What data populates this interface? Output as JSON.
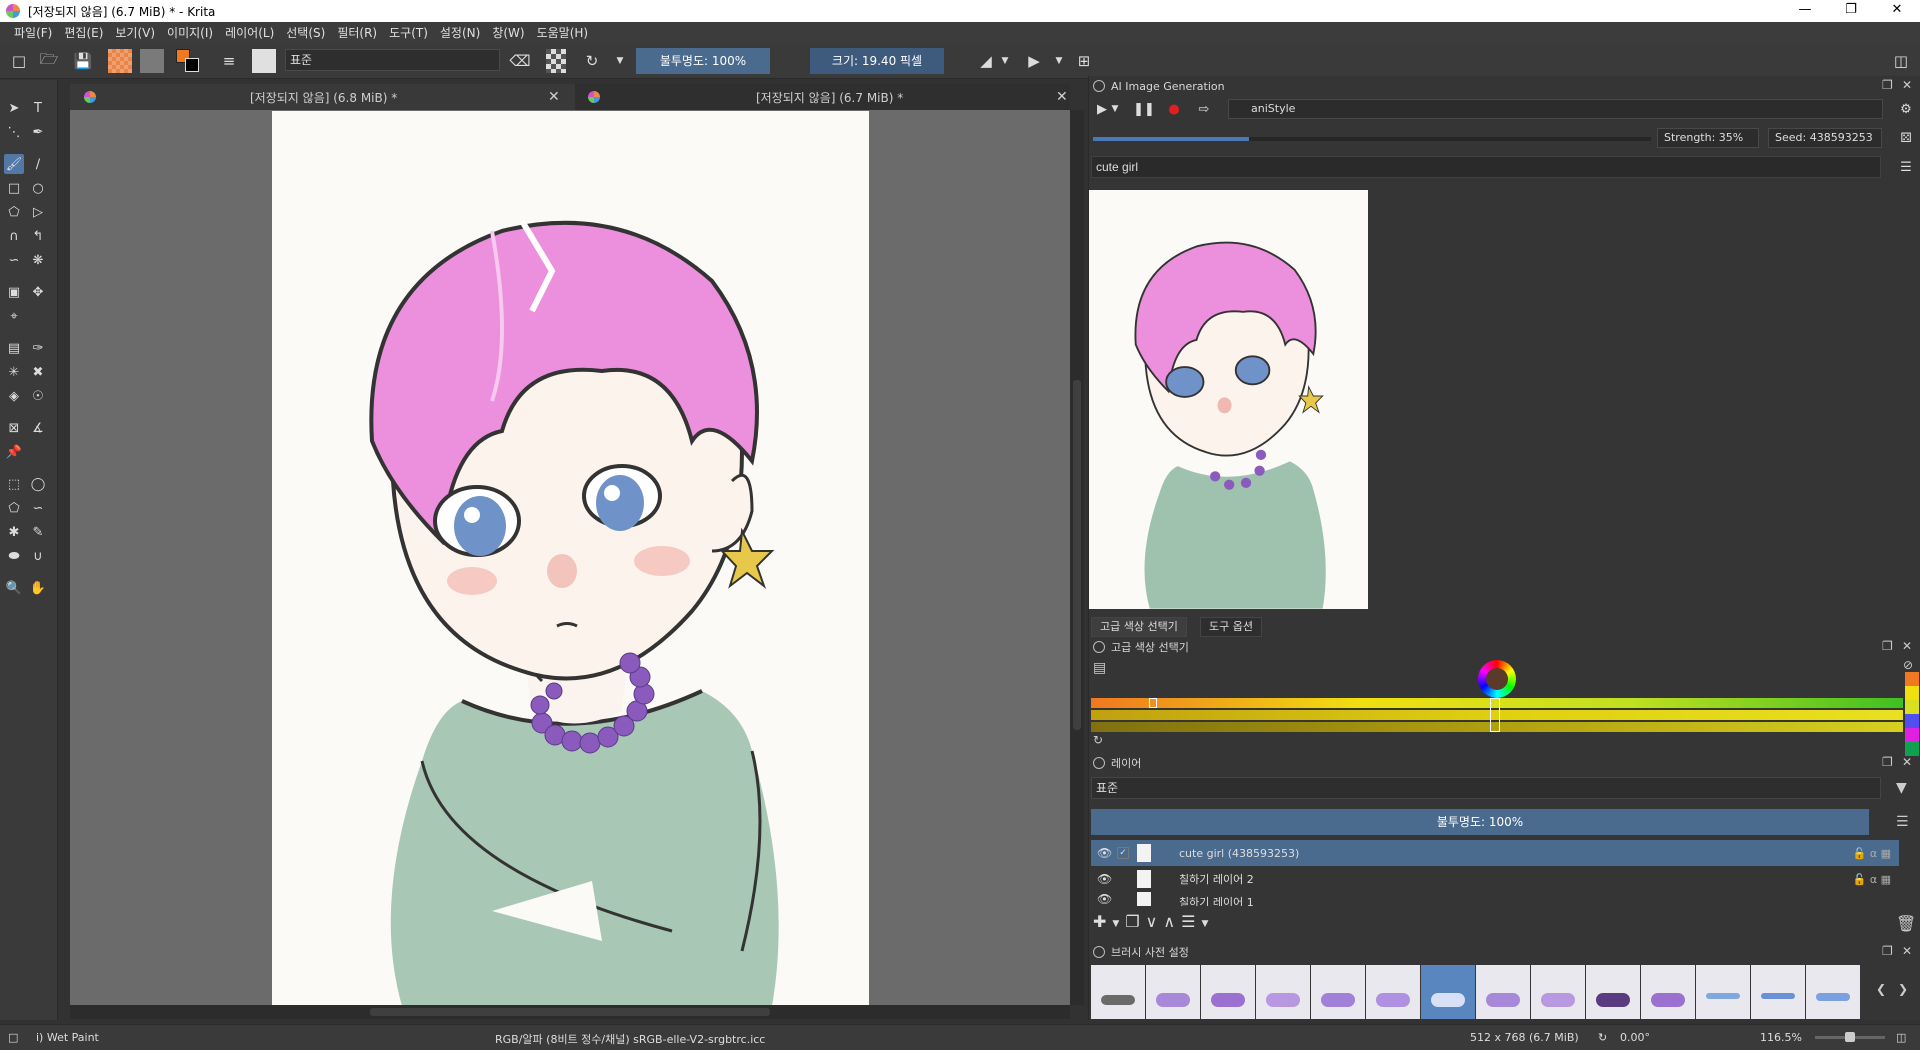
{
  "window": {
    "title": "[저장되지 않음]  (6.7 MiB) * - Krita",
    "minimize": "—",
    "maximize": "❐",
    "close": "✕"
  },
  "menu": [
    "파일(F)",
    "편집(E)",
    "보기(V)",
    "이미지(I)",
    "레이어(L)",
    "선택(S)",
    "필터(R)",
    "도구(T)",
    "설정(N)",
    "창(W)",
    "도움말(H)"
  ],
  "toolbar": {
    "preset_name": "표준",
    "opacity_label": "불투명도: 100%",
    "size_label": "크기: 19.40 픽셀"
  },
  "tabs": [
    {
      "title": "[저장되지 않음]  (6.8 MiB) *"
    },
    {
      "title": "[저장되지 않음]  (6.7 MiB) *"
    }
  ],
  "ai_docker": {
    "title": "AI Image Generation",
    "style": "aniStyle",
    "strength": "Strength: 35%",
    "seed": "Seed: 438593253",
    "prompt": "cute girl",
    "progress": 0.28
  },
  "docker_tabs": [
    "고급 색상 선택기",
    "도구 옵션"
  ],
  "color_docker": {
    "title": "고급 색상 선택기"
  },
  "layers_docker": {
    "title": "레이어",
    "blend_mode": "표준",
    "opacity": "불투명도:  100%",
    "layers": [
      {
        "name": "cute girl (438593253)",
        "selected": true
      },
      {
        "name": "칠하기 레이어 2",
        "selected": false
      },
      {
        "name": "칠하기 레이어 1",
        "selected": false
      }
    ]
  },
  "brush_docker": {
    "title": "브러시 사전 설정"
  },
  "status": {
    "brush": "i) Wet Paint",
    "color_profile": "RGB/알파 (8비트 정수/채널)  sRGB-elle-V2-srgbtrc.icc",
    "dimensions": "512 x 768 (6.7 MiB)",
    "rotation": "0.00°",
    "zoom": "116.5%"
  },
  "colors": {
    "accent": "#4a6a8e",
    "hair": "#ec8fdc",
    "shirt": "#9fc2ae",
    "necklace": "#8a5bbd",
    "eyes": "#6f93c9",
    "fg_color": "#f07820"
  }
}
